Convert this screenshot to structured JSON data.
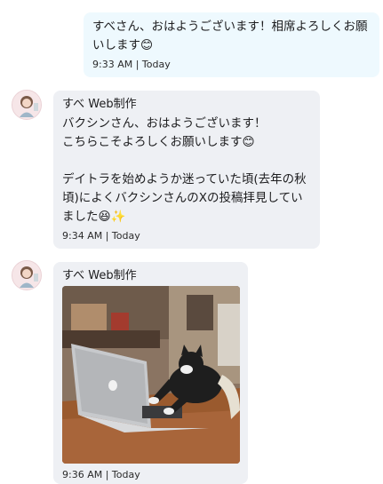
{
  "messages": [
    {
      "text": "すべさん、おはようございます！相席よろしくお願いします😊",
      "time": "9:33 AM | Today"
    },
    {
      "sender": "すべ Web制作",
      "text": "バクシンさん、おはようございます！\nこちらこそよろしくお願いします😊\n\nデイトラを始めようか迷っていた頃(去年の秋頃)によくバクシンさんのXの投稿拝見していました😆✨",
      "time": "9:34 AM | Today"
    },
    {
      "sender": "すべ Web制作",
      "image": "cat-typing-on-laptop-gif",
      "time": "9:36 AM | Today"
    }
  ],
  "colors": {
    "outgoing_bubble": "#eef9fe",
    "incoming_bubble": "#eef0f4"
  }
}
